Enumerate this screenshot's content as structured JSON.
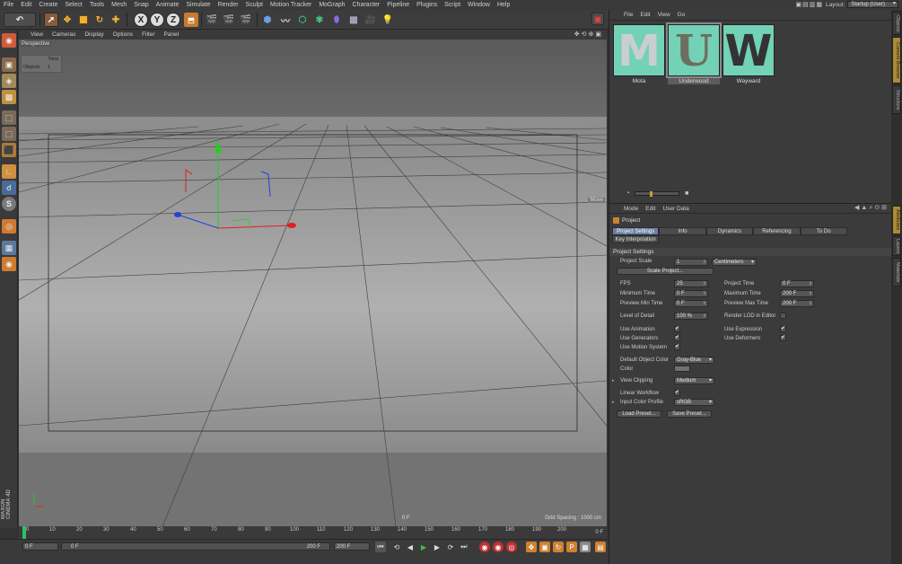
{
  "menubar": {
    "items": [
      "File",
      "Edit",
      "Create",
      "Select",
      "Tools",
      "Mesh",
      "Snap",
      "Animate",
      "Simulate",
      "Render",
      "Sculpt",
      "Motion Tracker",
      "MoGraph",
      "Character",
      "Pipeline",
      "Plugins",
      "Script",
      "Window",
      "Help"
    ],
    "layout_label": "Layout:",
    "layout_value": "Startup (User)"
  },
  "toolbar": {
    "axis_x": "X",
    "axis_y": "Y",
    "axis_z": "Z"
  },
  "viewport": {
    "menu": [
      "View",
      "Cameras",
      "Display",
      "Options",
      "Filter",
      "Panel"
    ],
    "camera_label": "Perspective",
    "hud_total": "Total",
    "hud_objects_label": "Objects",
    "hud_objects_count": "1",
    "move_label": "Move",
    "frame_indicator": "0 F",
    "grid_spacing": "Grid Spacing : 1000 cm"
  },
  "timeline": {
    "ticks": [
      "0",
      "10",
      "20",
      "30",
      "40",
      "50",
      "60",
      "70",
      "80",
      "90",
      "100",
      "110",
      "120",
      "130",
      "140",
      "150",
      "160",
      "170",
      "180",
      "190",
      "200"
    ],
    "current_frame": "0 F",
    "start_field": "0 F",
    "min_field": "0 F",
    "max_field": "200 F",
    "end_field": "200 F"
  },
  "maxon_text": "MAXON CINEMA 4D",
  "content_browser": {
    "menu": [
      "File",
      "Edit",
      "View",
      "Go"
    ],
    "items": [
      {
        "label": "Mota",
        "glyph": "M"
      },
      {
        "label": "Underwood",
        "glyph": "U"
      },
      {
        "label": "Wayward",
        "glyph": "W"
      }
    ]
  },
  "right_tabs": [
    "Objects",
    "Content Browser",
    "Structure",
    "Attributes",
    "Layers",
    "Materials"
  ],
  "attributes": {
    "menu": [
      "Mode",
      "Edit",
      "User Data"
    ],
    "title": "Project",
    "tabs": [
      "Project Settings",
      "Info",
      "Dynamics",
      "Referencing",
      "To Do",
      "Key Interpolation"
    ],
    "section": "Project Settings",
    "project_scale_label": "Project Scale",
    "project_scale_value": "1",
    "project_scale_unit": "Centimeters",
    "scale_project_button": "Scale Project...",
    "fps_label": "FPS",
    "fps_value": "25",
    "project_time_label": "Project Time",
    "project_time_value": "0 F",
    "min_time_label": "Minimum Time",
    "min_time_value": "0 F",
    "max_time_label": "Maximum Time",
    "max_time_value": "200 F",
    "preview_min_label": "Preview Min Time",
    "preview_min_value": "0 F",
    "preview_max_label": "Preview Max Time",
    "preview_max_value": "200 F",
    "lod_label": "Level of Detail",
    "lod_value": "100 %",
    "render_lod_label": "Render LOD in Editor",
    "use_animation_label": "Use Animation",
    "use_expression_label": "Use Expression",
    "use_generators_label": "Use Generators",
    "use_deformers_label": "Use Deformers",
    "use_motion_label": "Use Motion System",
    "default_color_label": "Default Object Color",
    "default_color_value": "Gray-Blue",
    "color_label": "Color",
    "view_clipping_label": "View Clipping",
    "view_clipping_value": "Medium",
    "linear_workflow_label": "Linear Workflow",
    "input_color_label": "Input Color Profile",
    "input_color_value": "sRGB",
    "load_preset_button": "Load Preset...",
    "save_preset_button": "Save Preset...",
    "check_mark": "✔"
  },
  "colors": {
    "accent": "#ad8a35",
    "tab_active": "#6b7fa6",
    "thumb_bg": "#73d1b5",
    "axis_x": "#e02020",
    "axis_y": "#20d020",
    "axis_z": "#2040e0"
  }
}
